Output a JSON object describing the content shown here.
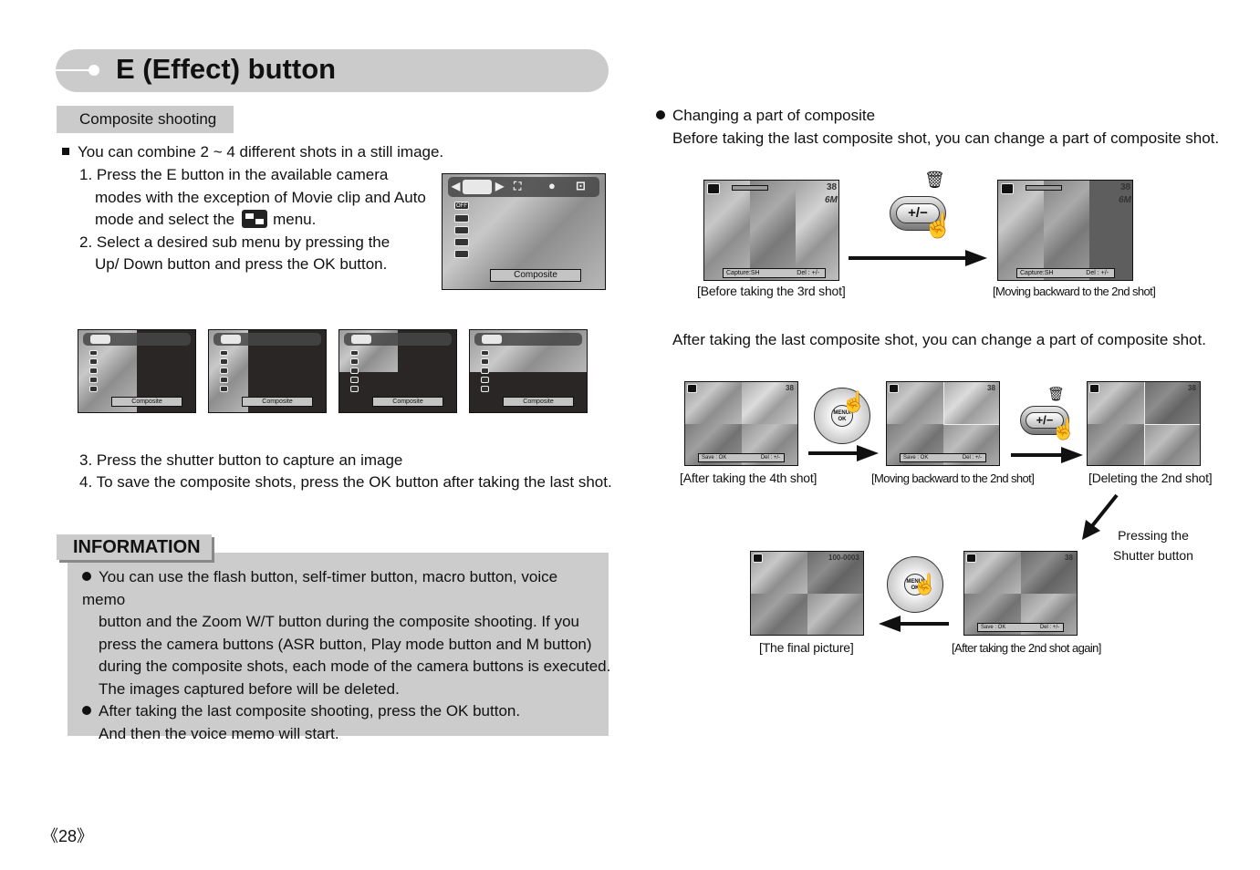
{
  "page": {
    "title": "E (Effect) button",
    "section_tag": "Composite shooting",
    "page_number": "《28》"
  },
  "left": {
    "intro": "You can combine 2 ~ 4 different shots in a still image.",
    "steps": {
      "s1_l1": "1. Press the E button in the available camera",
      "s1_l2": "modes with the exception of Movie clip and Auto",
      "s1_l3a": "mode and select the",
      "s1_l3b": "menu.",
      "s2_l1": "2. Select a desired sub menu by pressing the",
      "s2_l2": "Up/ Down button and press the OK button.",
      "s3": "3. Press the shutter button to capture an image",
      "s4": "4. To save the composite shots, press the OK button after taking the last shot."
    },
    "main_screen": {
      "caption": "Composite",
      "side_icons": [
        "OFF",
        "2-split",
        "3-split",
        "4-grid",
        "2-horizontal"
      ]
    },
    "sub_screens": [
      {
        "caption": "Composite",
        "layout": "2 shots"
      },
      {
        "caption": "Composite",
        "layout": "3 shots"
      },
      {
        "caption": "Composite",
        "layout": "4 shots"
      },
      {
        "caption": "Composite",
        "layout": "2 shots horizontal"
      }
    ]
  },
  "information": {
    "tag": "INFORMATION",
    "bullets": [
      {
        "lines": [
          "You can use the flash button, self-timer button, macro button, voice memo",
          "button and the Zoom W/T button during the composite shooting. If you",
          "press the camera buttons (ASR button, Play mode button and M button)",
          "during the composite shots, each mode of the camera buttons is executed.",
          "The images captured before will be deleted."
        ]
      },
      {
        "lines": [
          "After taking the last composite shooting, press the OK button.",
          "And then the voice memo will start."
        ]
      }
    ]
  },
  "right": {
    "heading": "Changing a part of composite",
    "before_text": "Before taking the last composite shot, you can change a part of composite shot.",
    "after_text": "After taking the last composite shot, you can change a part of composite shot.",
    "before_sequence": {
      "screen1": {
        "status_left": "Capture:SH",
        "status_right": "Del : +/-",
        "count": "38",
        "size": "6M",
        "caption": "[Before taking the 3rd shot]"
      },
      "button_label": "+/−",
      "screen2": {
        "status_left": "Capture:SH",
        "status_right": "Del : +/-",
        "count": "38",
        "size": "6M",
        "caption": "[Moving backward to the 2nd shot]"
      }
    },
    "after_sequence": {
      "screen1": {
        "status_left": "Save : OK",
        "status_right": "Del : +/-",
        "count": "38",
        "caption": "[After taking the 4th shot]"
      },
      "dial_center": "MENU/ OK",
      "screen2": {
        "status_left": "Save : OK",
        "status_right": "Del : +/-",
        "count": "38",
        "caption": "[Moving backward to the 2nd shot]"
      },
      "button_label": "+/−",
      "screen3": {
        "count": "38",
        "caption": "[Deleting the 2nd shot]"
      },
      "shutter_note_l1": "Pressing the",
      "shutter_note_l2": "Shutter button",
      "screen4": {
        "status_left": "Save : OK",
        "status_right": "Del : +/-",
        "count": "38",
        "caption": "[After taking the 2nd shot again]"
      },
      "screen5": {
        "file_no": "100-0003",
        "caption": "[The final picture]"
      }
    }
  }
}
